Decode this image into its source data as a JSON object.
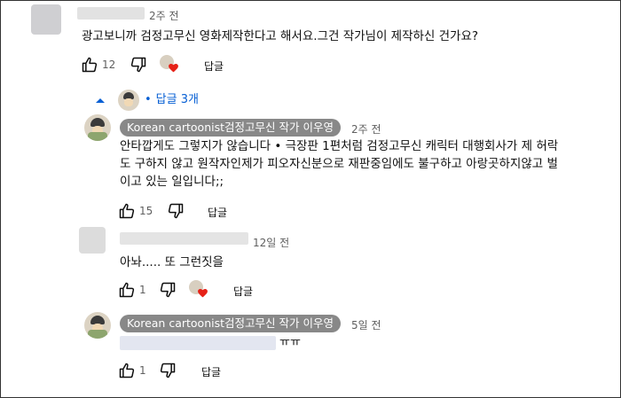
{
  "comments": [
    {
      "time": "2주 전",
      "text": "광고보니까 검정고무신 영화제작한다고 해서요.그건 작가님이 제작하신 건가요?",
      "likes": "12",
      "reply_label": "답글"
    }
  ],
  "thread": {
    "replies_toggle": "답글 3개",
    "replies": [
      {
        "author": "Korean cartoonist검정고무신 작가 이우영",
        "time": "2주 전",
        "text_lines": [
          "안타깝게도 그렇지가 않습니다 • 극장판 1편처럼 검정고무신 캐릭터 대행회사가 제 허락",
          "도 구하지 않고 원작자인제가 피오자신분으로 재판중임에도 불구하고 아랑곳하지않고 벌",
          "이고 있는 일입니다;;"
        ],
        "likes": "15",
        "reply_label": "답글"
      },
      {
        "time": "12일 전",
        "text": "아놔..... 또 그런짓을",
        "likes": "1",
        "reply_label": "답글"
      },
      {
        "author": "Korean cartoonist검정고무신 작가 이우영",
        "time": "5일 전",
        "text_suffix": "ㅠㅠ",
        "likes": "1",
        "reply_label": "답글"
      }
    ]
  },
  "icons": [
    "thumbs-up-icon",
    "thumbs-down-icon",
    "creator-heart-icon",
    "chevron-up-icon"
  ],
  "colors": {
    "link": "#065fd4",
    "chip": "#888888",
    "heart": "#e62117",
    "text_secondary": "#606060"
  }
}
